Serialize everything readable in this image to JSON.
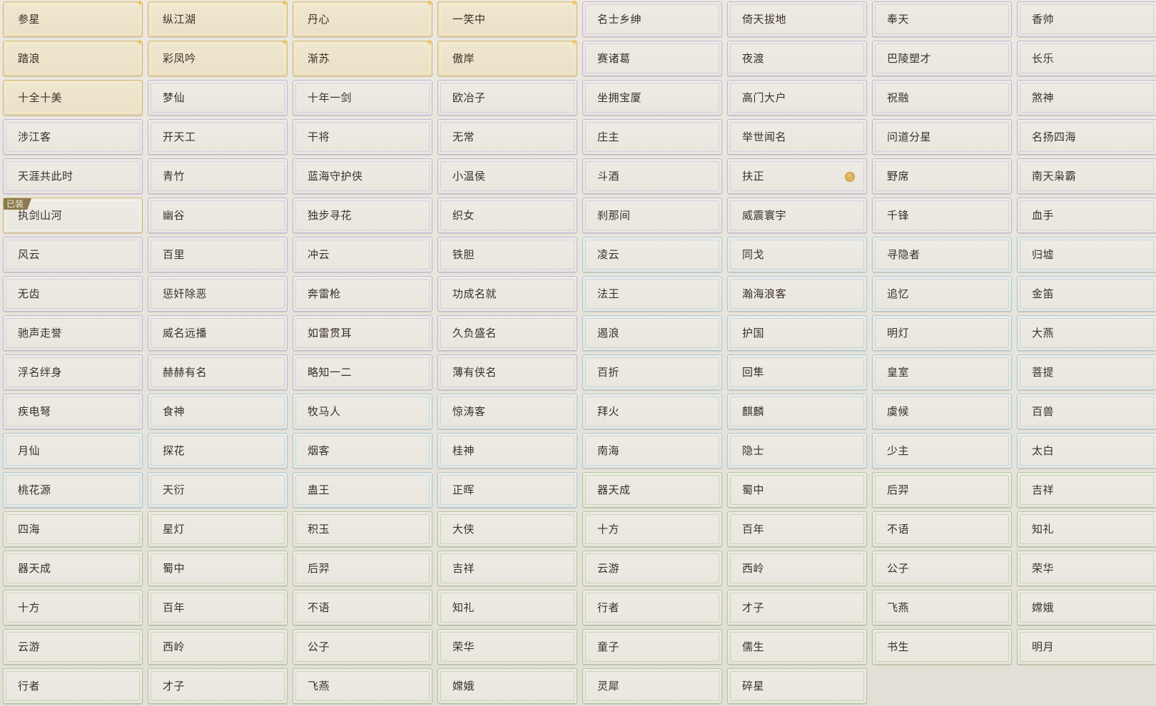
{
  "titles": [
    {
      "label": "参星",
      "tier": "gold",
      "sparkle": true
    },
    {
      "label": "纵江湖",
      "tier": "gold",
      "sparkle": true
    },
    {
      "label": "丹心",
      "tier": "gold",
      "sparkle": true
    },
    {
      "label": "一笑中",
      "tier": "gold",
      "sparkle": true
    },
    {
      "label": "名士乡绅",
      "tier": "purple"
    },
    {
      "label": "倚天拔地",
      "tier": "purple"
    },
    {
      "label": "奉天",
      "tier": "purple"
    },
    {
      "label": "香帅",
      "tier": "purple"
    },
    {
      "label": "踏浪",
      "tier": "gold",
      "sparkle": true
    },
    {
      "label": "彩凤吟",
      "tier": "gold",
      "sparkle": true
    },
    {
      "label": "渐苏",
      "tier": "gold",
      "sparkle": true
    },
    {
      "label": "傲岸",
      "tier": "gold",
      "sparkle": true
    },
    {
      "label": "赛诸葛",
      "tier": "purple"
    },
    {
      "label": "夜渡",
      "tier": "purple"
    },
    {
      "label": "巴陵塑才",
      "tier": "purple"
    },
    {
      "label": "长乐",
      "tier": "purple"
    },
    {
      "label": "十全十美",
      "tier": "gold"
    },
    {
      "label": "梦仙",
      "tier": "purple"
    },
    {
      "label": "十年一剑",
      "tier": "purple"
    },
    {
      "label": "欧冶子",
      "tier": "purple"
    },
    {
      "label": "坐拥宝厦",
      "tier": "purple"
    },
    {
      "label": "高门大户",
      "tier": "purple"
    },
    {
      "label": "祝融",
      "tier": "purple"
    },
    {
      "label": "煞神",
      "tier": "purple"
    },
    {
      "label": "涉江客",
      "tier": "purple"
    },
    {
      "label": "开天工",
      "tier": "purple"
    },
    {
      "label": "干将",
      "tier": "purple"
    },
    {
      "label": "无常",
      "tier": "purple"
    },
    {
      "label": "庄主",
      "tier": "purple"
    },
    {
      "label": "举世闻名",
      "tier": "purple"
    },
    {
      "label": "问道分星",
      "tier": "purple"
    },
    {
      "label": "名扬四海",
      "tier": "purple"
    },
    {
      "label": "天涯共此时",
      "tier": "purple"
    },
    {
      "label": "青竹",
      "tier": "purple"
    },
    {
      "label": "蓝海守护侠",
      "tier": "purple"
    },
    {
      "label": "小温侯",
      "tier": "purple"
    },
    {
      "label": "斗酒",
      "tier": "purple"
    },
    {
      "label": "扶正",
      "tier": "purple",
      "timed": true
    },
    {
      "label": "野席",
      "tier": "purple"
    },
    {
      "label": "南天枭霸",
      "tier": "purple"
    },
    {
      "label": "执剑山河",
      "tier": "active",
      "badge": "已装"
    },
    {
      "label": "幽谷",
      "tier": "purple"
    },
    {
      "label": "独步寻花",
      "tier": "purple"
    },
    {
      "label": "织女",
      "tier": "purple"
    },
    {
      "label": "刹那间",
      "tier": "purple"
    },
    {
      "label": "威震寰宇",
      "tier": "purple"
    },
    {
      "label": "千锋",
      "tier": "purple"
    },
    {
      "label": "血手",
      "tier": "purple"
    },
    {
      "label": "风云",
      "tier": "purple"
    },
    {
      "label": "百里",
      "tier": "purple"
    },
    {
      "label": "冲云",
      "tier": "purple"
    },
    {
      "label": "铁胆",
      "tier": "purple"
    },
    {
      "label": "凌云",
      "tier": "blue"
    },
    {
      "label": "同戈",
      "tier": "blue"
    },
    {
      "label": "寻隐者",
      "tier": "blue"
    },
    {
      "label": "归墟",
      "tier": "blue"
    },
    {
      "label": "无齿",
      "tier": "purple"
    },
    {
      "label": "惩奸除恶",
      "tier": "purple"
    },
    {
      "label": "奔雷枪",
      "tier": "purple"
    },
    {
      "label": "功成名就",
      "tier": "purple"
    },
    {
      "label": "法王",
      "tier": "blue"
    },
    {
      "label": "瀚海浪客",
      "tier": "blue"
    },
    {
      "label": "追忆",
      "tier": "blue"
    },
    {
      "label": "金笛",
      "tier": "blue"
    },
    {
      "label": "驰声走誉",
      "tier": "purple"
    },
    {
      "label": "威名远播",
      "tier": "purple"
    },
    {
      "label": "如雷贯耳",
      "tier": "purple"
    },
    {
      "label": "久负盛名",
      "tier": "purple"
    },
    {
      "label": "遏浪",
      "tier": "blue"
    },
    {
      "label": "护国",
      "tier": "blue"
    },
    {
      "label": "明灯",
      "tier": "blue"
    },
    {
      "label": "大燕",
      "tier": "blue"
    },
    {
      "label": "浮名绊身",
      "tier": "purple"
    },
    {
      "label": "赫赫有名",
      "tier": "purple"
    },
    {
      "label": "略知一二",
      "tier": "purple"
    },
    {
      "label": "薄有侠名",
      "tier": "purple"
    },
    {
      "label": "百折",
      "tier": "blue"
    },
    {
      "label": "回隼",
      "tier": "blue"
    },
    {
      "label": "皇室",
      "tier": "blue"
    },
    {
      "label": "菩提",
      "tier": "blue"
    },
    {
      "label": "疾电弩",
      "tier": "purple"
    },
    {
      "label": "食神",
      "tier": "blue"
    },
    {
      "label": "牧马人",
      "tier": "blue"
    },
    {
      "label": "惊涛客",
      "tier": "blue"
    },
    {
      "label": "拜火",
      "tier": "blue"
    },
    {
      "label": "麒麟",
      "tier": "blue"
    },
    {
      "label": "虞候",
      "tier": "blue"
    },
    {
      "label": "百兽",
      "tier": "blue"
    },
    {
      "label": "月仙",
      "tier": "blue"
    },
    {
      "label": "探花",
      "tier": "blue"
    },
    {
      "label": "烟客",
      "tier": "blue"
    },
    {
      "label": "桂神",
      "tier": "blue"
    },
    {
      "label": "南海",
      "tier": "blue"
    },
    {
      "label": "隐士",
      "tier": "blue"
    },
    {
      "label": "少主",
      "tier": "blue"
    },
    {
      "label": "太白",
      "tier": "blue"
    },
    {
      "label": "桃花源",
      "tier": "blue"
    },
    {
      "label": "天衍",
      "tier": "blue"
    },
    {
      "label": "蛊王",
      "tier": "blue"
    },
    {
      "label": "正晖",
      "tier": "blue"
    },
    {
      "label": "器天成",
      "tier": "green"
    },
    {
      "label": "蜀中",
      "tier": "green"
    },
    {
      "label": "后羿",
      "tier": "green"
    },
    {
      "label": "吉祥",
      "tier": "green"
    },
    {
      "label": "四海",
      "tier": "green"
    },
    {
      "label": "星灯",
      "tier": "green"
    },
    {
      "label": "积玉",
      "tier": "green"
    },
    {
      "label": "大侠",
      "tier": "green"
    },
    {
      "label": "十方",
      "tier": "green"
    },
    {
      "label": "百年",
      "tier": "green"
    },
    {
      "label": "不语",
      "tier": "green"
    },
    {
      "label": "知礼",
      "tier": "green"
    },
    {
      "label": "器天成",
      "tier": "green"
    },
    {
      "label": "蜀中",
      "tier": "green"
    },
    {
      "label": "后羿",
      "tier": "green"
    },
    {
      "label": "吉祥",
      "tier": "green"
    },
    {
      "label": "云游",
      "tier": "green"
    },
    {
      "label": "西岭",
      "tier": "green"
    },
    {
      "label": "公子",
      "tier": "green"
    },
    {
      "label": "荣华",
      "tier": "green"
    },
    {
      "label": "十方",
      "tier": "green"
    },
    {
      "label": "百年",
      "tier": "green"
    },
    {
      "label": "不语",
      "tier": "green"
    },
    {
      "label": "知礼",
      "tier": "green"
    },
    {
      "label": "行者",
      "tier": "green"
    },
    {
      "label": "才子",
      "tier": "green"
    },
    {
      "label": "飞燕",
      "tier": "green"
    },
    {
      "label": "嫦娥",
      "tier": "green"
    },
    {
      "label": "云游",
      "tier": "green"
    },
    {
      "label": "西岭",
      "tier": "green"
    },
    {
      "label": "公子",
      "tier": "green"
    },
    {
      "label": "荣华",
      "tier": "green"
    },
    {
      "label": "童子",
      "tier": "green"
    },
    {
      "label": "儒生",
      "tier": "green"
    },
    {
      "label": "书生",
      "tier": "green"
    },
    {
      "label": "明月",
      "tier": "green"
    },
    {
      "label": "行者",
      "tier": "green"
    },
    {
      "label": "才子",
      "tier": "green"
    },
    {
      "label": "飞燕",
      "tier": "green"
    },
    {
      "label": "嫦娥",
      "tier": "green"
    },
    {
      "label": "灵犀",
      "tier": "green"
    },
    {
      "label": "碎星",
      "tier": "green"
    }
  ]
}
